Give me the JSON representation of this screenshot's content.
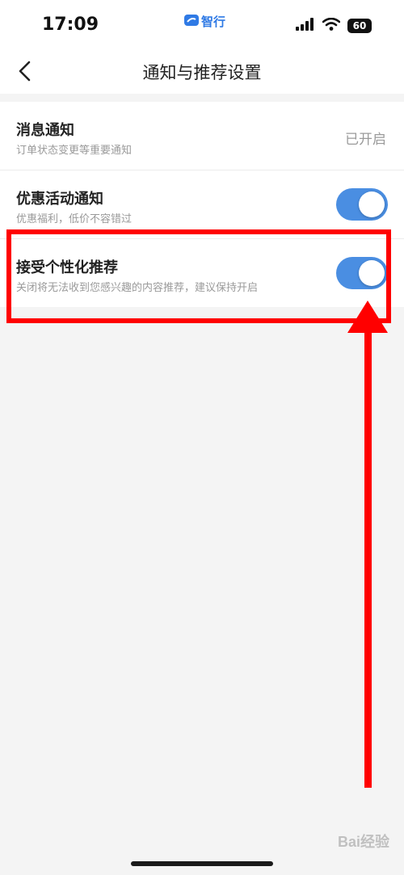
{
  "status_bar": {
    "time": "17:09",
    "app_name": "智行",
    "battery": "60"
  },
  "nav": {
    "title": "通知与推荐设置"
  },
  "settings": [
    {
      "title": "消息通知",
      "subtitle": "订单状态变更等重要通知",
      "value": "已开启"
    },
    {
      "title": "优惠活动通知",
      "subtitle": "优惠福利，低价不容错过",
      "toggle_on": true
    },
    {
      "title": "接受个性化推荐",
      "subtitle": "关闭将无法收到您感兴趣的内容推荐，建议保持开启",
      "toggle_on": true
    }
  ],
  "watermark": "Bai经验",
  "colors": {
    "accent": "#4a8ee2",
    "annotation": "#ff0000",
    "app_brand": "#2f7ae5"
  }
}
